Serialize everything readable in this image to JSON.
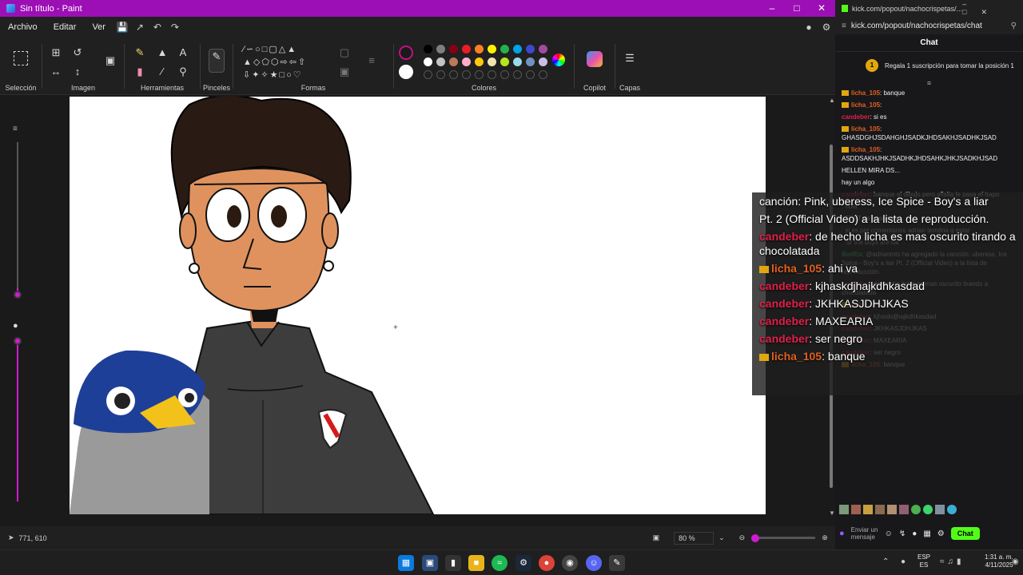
{
  "paint": {
    "title": "Sin título - Paint",
    "menus": [
      "Archivo",
      "Editar",
      "Ver"
    ],
    "groups": {
      "seleccion": "Selección",
      "imagen": "Imagen",
      "herramientas": "Herramientas",
      "pinceles": "Pinceles",
      "formas": "Formas",
      "colores": "Colores",
      "copilot": "Copilot",
      "capas": "Capas"
    },
    "status": {
      "cursor_pos": "771, 610",
      "zoom": "80 %"
    },
    "palette": [
      "#000000",
      "#7f7f7f",
      "#880015",
      "#ed1c24",
      "#ff7f27",
      "#fff200",
      "#22b14c",
      "#00a2e8",
      "#3f48cc",
      "#a349a4",
      "#ffffff",
      "#c3c3c3",
      "#b97a57",
      "#ffaec9",
      "#ffc90e",
      "#efe4b0",
      "#b5e61d",
      "#99d9ea",
      "#7092be",
      "#c8bfe7"
    ],
    "accent": "#9c0fb5"
  },
  "chat": {
    "title": "kick.com/popout/nachocrispetas/...",
    "url": "kick.com/popout/nachocrispetas/chat",
    "header": "Chat",
    "pinned": "Regala 1 suscripción para tomar la posición 1",
    "pinned_rank": "1",
    "messages": [
      {
        "user": "licha_105",
        "text": ": banque"
      },
      {
        "user": "licha_105",
        "text": ":"
      },
      {
        "user": "candeber",
        "text": ": si es"
      },
      {
        "user": "licha_105",
        "text": ": GHASDGHJSDAHGHJSADKJHDSAKHJSADHKJSAD"
      },
      {
        "user": "licha_105",
        "text": ": ASDDSAKHJHKJSADHKJHDSAHKJHKJSADKHJSAD"
      },
      {
        "user": "",
        "text": "HELLEN MIRA DS..."
      },
      {
        "user": "",
        "text": "hay un algo"
      },
      {
        "user": "candeber",
        "text": ": banque el dibujo pero efisita te pasa el trapo"
      },
      {
        "user": "",
        "text": ": hola"
      },
      {
        "user": "",
        "text": ": TEST de la amistad"
      },
      {
        "user": "",
        "text": ": si es por comentarios adrian temdria q estar"
      },
      {
        "user": "",
        "text": ": !sr the boys are liar"
      },
      {
        "user": "BotRix",
        "text": ": @adrianmts ha agregado la canción: uberess, Ice Spice - Boy's a liar Pt. 2 (Official Video) a la lista de reproducción."
      },
      {
        "user": "candeber",
        "text": ": de hecho licha es mas oscurito tirando a chocolatada"
      },
      {
        "user": "licha_105",
        "text": ": ahi va"
      },
      {
        "user": "candeber",
        "text": ": kjhaskdjhajkdhkasdad"
      },
      {
        "user": "candeber",
        "text": ": JKHKASJDHJKAS"
      },
      {
        "user": "candeber",
        "text": ": MAXEARIA"
      },
      {
        "user": "candeber",
        "text": ": ser negro"
      },
      {
        "user": "licha_105",
        "text": ": banque"
      }
    ],
    "input_placeholder": "Enviar un mensaje",
    "send_label": "Chat"
  },
  "overlay": {
    "lines": [
      {
        "user": "",
        "text": "canción: Pink, uberess, Ice Spice - Boy's a liar"
      },
      {
        "user": "",
        "text": "Pt. 2 (Official Video) a la lista de reproducción."
      },
      {
        "user": "candeber",
        "text": ": de hecho licha es mas oscurito tirando a chocolatada"
      },
      {
        "user": "licha_105",
        "text": ": ahi va"
      },
      {
        "user": "candeber",
        "text": ": kjhaskdjhajkdhkasdad"
      },
      {
        "user": "candeber",
        "text": ": JKHKASJDHJKAS"
      },
      {
        "user": "candeber",
        "text": ": MAXEARIA"
      },
      {
        "user": "candeber",
        "text": ": ser negro"
      },
      {
        "user": "licha_105",
        "text": ": banque"
      }
    ]
  },
  "taskbar": {
    "lang": "ESP",
    "lang_sub": "ES",
    "time": "1:31 a. m.",
    "date": "4/11/2025"
  },
  "colors": {
    "user_candeber": "#e0204a",
    "user_licha": "#e06020",
    "user_botrix": "#3fd46a"
  }
}
